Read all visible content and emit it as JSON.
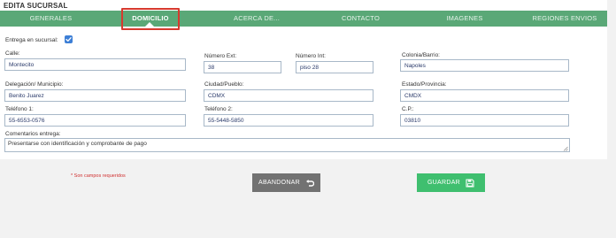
{
  "page": {
    "title": "EDITA SUCURSAL"
  },
  "tabs": [
    {
      "label": "GENERALES",
      "active": false
    },
    {
      "label": "DOMICILIO",
      "active": true
    },
    {
      "label": "ACERCA DE...",
      "active": false
    },
    {
      "label": "CONTACTO",
      "active": false
    },
    {
      "label": "IMAGENES",
      "active": false
    },
    {
      "label": "REGIONES ENVIOS",
      "active": false
    }
  ],
  "form": {
    "delivery": {
      "label": "Entrega en sucursal:",
      "checked": true
    },
    "street": {
      "label": "Calle:",
      "value": "Montecito"
    },
    "ext_number": {
      "label": "Número Ext:",
      "value": "38"
    },
    "int_number": {
      "label": "Número Int:",
      "value": "piso 28"
    },
    "colony": {
      "label": "Colonia/Barrio:",
      "value": "Napoles"
    },
    "delegation": {
      "label": "Delegación/ Municipio:",
      "value": "Benito Juarez"
    },
    "city": {
      "label": "Ciudad/Pueblo:",
      "value": "CDMX"
    },
    "state": {
      "label": "Estado/Provincia:",
      "value": "CMDX"
    },
    "phone1": {
      "label": "Teléfono 1:",
      "value": "55-6553-0576"
    },
    "phone2": {
      "label": "Teléfono 2:",
      "value": "55-5448-5850"
    },
    "zip": {
      "label": "C.P.:",
      "value": "03810"
    },
    "comments": {
      "label": "Comentarios entrega:",
      "value": "Presentarse con identificación y comprobante de pago"
    }
  },
  "footer": {
    "required_note": "* Son campos requeridos",
    "abandon_label": "ABANDONAR",
    "save_label": "GUARDAR"
  },
  "colors": {
    "tab_bar": "#5aa877",
    "highlight": "#d63a2e",
    "save_button": "#3fbf6f",
    "abandon_button": "#727272",
    "checkbox": "#3d7fd6"
  },
  "icons": {
    "checkbox": "check-icon",
    "abandon": "undo-arrow-icon",
    "save": "floppy-disk-icon"
  }
}
